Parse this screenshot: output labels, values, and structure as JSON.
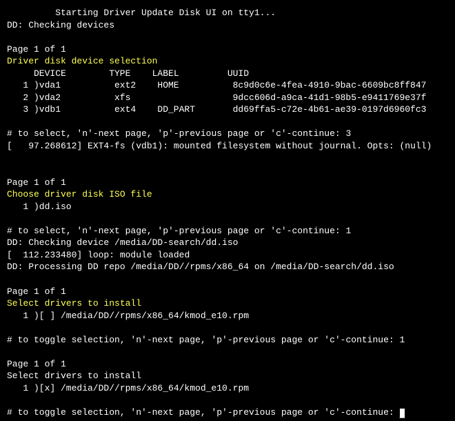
{
  "banner": "Starting Driver Update Disk UI on tty1...",
  "dd_check": "DD: Checking devices",
  "page_label": "Page 1 of 1",
  "sec1": {
    "title": "Driver disk device selection",
    "headers": {
      "device": "DEVICE",
      "type": "TYPE",
      "label": "LABEL",
      "uuid": "UUID"
    },
    "rows": [
      {
        "idx": "1",
        "device": "vda1",
        "type": "ext2",
        "label": "HOME",
        "uuid": "8c9d0c6e-4fea-4910-9bac-6609bc8ff847"
      },
      {
        "idx": "2",
        "device": "vda2",
        "type": "xfs",
        "label": "",
        "uuid": "9dcc606d-a9ca-41d1-98b5-e9411769e37f"
      },
      {
        "idx": "3",
        "device": "vdb1",
        "type": "ext4",
        "label": "DD_PART",
        "uuid": "dd69ffa5-c72e-4b61-ae39-0197d6960fc3"
      }
    ],
    "prompt": "# to select, 'n'-next page, 'p'-previous page or 'c'-continue: 3",
    "kmsg": "[   97.268612] EXT4-fs (vdb1): mounted filesystem without journal. Opts: (null)"
  },
  "sec2": {
    "title": "Choose driver disk ISO file",
    "items": [
      {
        "idx": "1",
        "name": "dd.iso"
      }
    ],
    "prompt": "# to select, 'n'-next page, 'p'-previous page or 'c'-continue: 1",
    "msg1": "DD: Checking device /media/DD-search/dd.iso",
    "msg2": "[  112.233480] loop: module loaded",
    "msg3": "DD: Processing DD repo /media/DD//rpms/x86_64 on /media/DD-search/dd.iso"
  },
  "sec3": {
    "title": "Select drivers to install",
    "items": [
      {
        "idx": "1",
        "box": "[ ]",
        "name": "/media/DD//rpms/x86_64/kmod_e10.rpm"
      }
    ],
    "prompt": "# to toggle selection, 'n'-next page, 'p'-previous page or 'c'-continue: 1"
  },
  "sec4": {
    "title": "Select drivers to install",
    "items": [
      {
        "idx": "1",
        "box": "[x]",
        "name": "/media/DD//rpms/x86_64/kmod_e10.rpm"
      }
    ],
    "prompt": "# to toggle selection, 'n'-next page, 'p'-previous page or 'c'-continue: "
  }
}
